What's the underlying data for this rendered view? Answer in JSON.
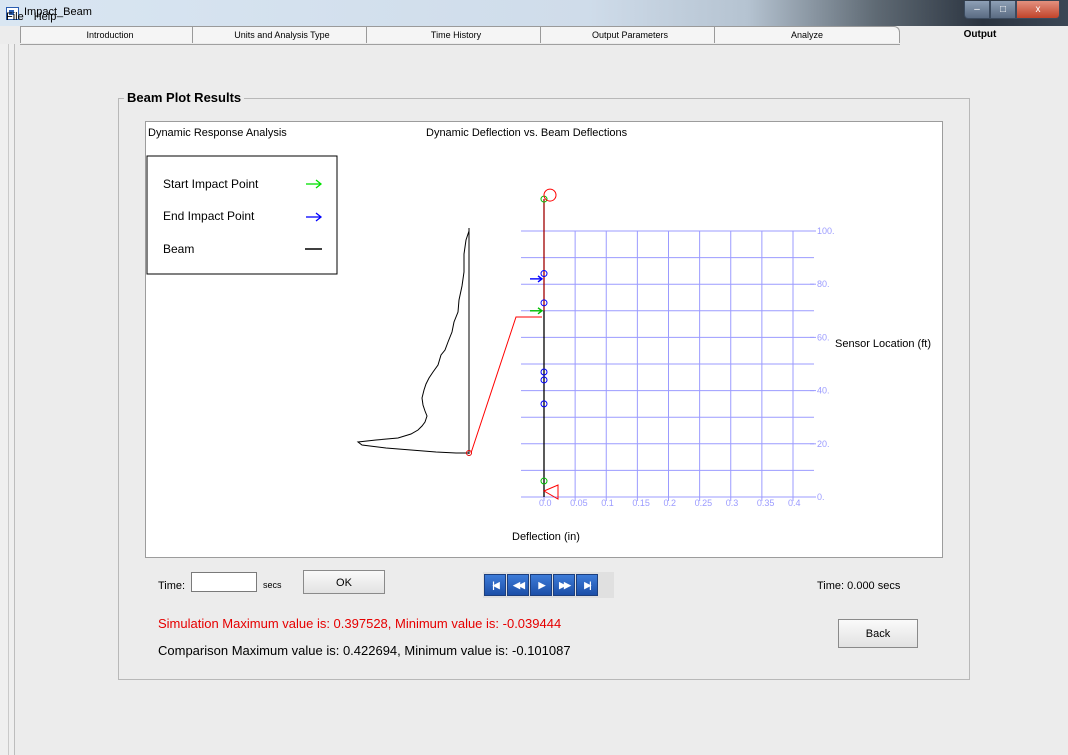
{
  "window": {
    "title": "Impact_Beam",
    "buttons": [
      "–",
      "□",
      "x"
    ]
  },
  "menu": {
    "items": [
      "File",
      "Help"
    ]
  },
  "tabs": [
    {
      "label": "Introduction",
      "active": false
    },
    {
      "label": "Units and Analysis Type",
      "active": false
    },
    {
      "label": "Time History",
      "active": false
    },
    {
      "label": "Output Parameters",
      "active": false
    },
    {
      "label": "Analyze",
      "active": false
    },
    {
      "label": "Output",
      "active": true
    }
  ],
  "group": {
    "title": "Beam Plot Results"
  },
  "plot": {
    "left_title": "Dynamic Response Analysis",
    "center_title": "Dynamic Deflection vs. Beam Deflections",
    "legend": [
      {
        "label": "Start Impact Point",
        "color": "#00e000",
        "symbol": "arrow"
      },
      {
        "label": "End Impact Point",
        "color": "#0000ff",
        "symbol": "arrow"
      },
      {
        "label": "Beam",
        "color": "#000000",
        "symbol": "line"
      }
    ],
    "xlabel": "Deflection (in)",
    "ylabel": "Sensor Location (ft)",
    "grid_color": "#9b9bff"
  },
  "chart_data": {
    "type": "line",
    "xlabel": "Deflection (in)",
    "ylabel": "Sensor Location (ft)",
    "xticks": [
      "0.0",
      "0.05",
      "0.1",
      "0.15",
      "0.2",
      "0.25",
      "0.3",
      "0.35",
      "0.4"
    ],
    "yticks": [
      "0.",
      "20.",
      "40.",
      "60.",
      "80.",
      "100."
    ],
    "xlim": [
      0,
      0.4
    ],
    "ylim": [
      0,
      100
    ],
    "grid": true,
    "series": [
      {
        "name": "Beam",
        "color": "#000000",
        "x": [
          0,
          0
        ],
        "y": [
          0,
          100
        ]
      },
      {
        "name": "Start Impact Point",
        "color": "#00e000",
        "points": [
          [
            0,
            70
          ],
          [
            0,
            6
          ],
          [
            0,
            112
          ]
        ]
      },
      {
        "name": "End Impact Point",
        "color": "#0000ff",
        "points": [
          [
            0,
            82
          ],
          [
            0,
            84
          ],
          [
            0,
            73
          ],
          [
            0,
            47
          ],
          [
            0,
            44
          ],
          [
            0,
            35
          ]
        ]
      }
    ]
  },
  "controls": {
    "time_label": "Time:",
    "time_value": "",
    "secs_label": "secs",
    "ok_label": "OK",
    "player_buttons": [
      {
        "name": "first-frame-icon",
        "glyph": "|◀"
      },
      {
        "name": "rewind-icon",
        "glyph": "◀◀"
      },
      {
        "name": "play-icon",
        "glyph": "▶"
      },
      {
        "name": "fast-forward-icon",
        "glyph": "▶▶"
      },
      {
        "name": "last-frame-icon",
        "glyph": "▶|"
      }
    ],
    "time_status": "Time: 0.000 secs",
    "back_label": "Back"
  },
  "messages": {
    "simulation": "Simulation Maximum value is: 0.397528, Minimum value is: -0.039444",
    "comparison": "Comparison Maximum value is: 0.422694, Minimum value is: -0.101087"
  }
}
